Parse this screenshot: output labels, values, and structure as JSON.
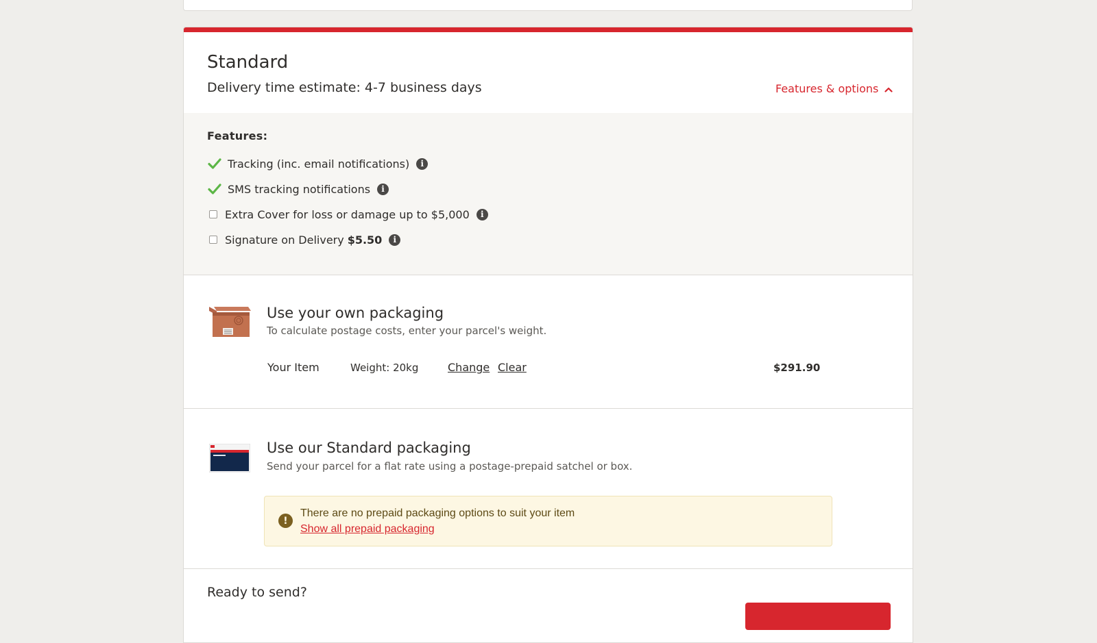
{
  "service": {
    "title": "Standard",
    "estimate": "Delivery time estimate: 4-7 business days",
    "features_toggle_label": "Features & options"
  },
  "features": {
    "heading": "Features:",
    "items": [
      {
        "label": "Tracking (inc. email notifications)",
        "included": true
      },
      {
        "label": "SMS tracking notifications",
        "included": true
      },
      {
        "label": "Extra Cover for loss or damage up to $5,000",
        "included": false
      },
      {
        "label": "Signature on Delivery",
        "price": "$5.50",
        "included": false
      }
    ]
  },
  "own_packaging": {
    "title": "Use your own packaging",
    "subtitle": "To calculate postage costs, enter your parcel's weight.",
    "item_label": "Your Item",
    "weight": "Weight: 20kg",
    "change_label": "Change",
    "clear_label": "Clear",
    "price": "$291.90"
  },
  "standard_packaging": {
    "title": "Use our Standard packaging",
    "subtitle": "Send your parcel for a flat rate using a postage-prepaid satchel or box.",
    "alert_text": "There are no prepaid packaging options to suit your item",
    "alert_link": "Show all prepaid packaging"
  },
  "ready": {
    "title": "Ready to send?"
  },
  "colors": {
    "brand_red": "#d7262e",
    "check_green": "#5cb646",
    "alert_bg": "#fdf7e3"
  }
}
